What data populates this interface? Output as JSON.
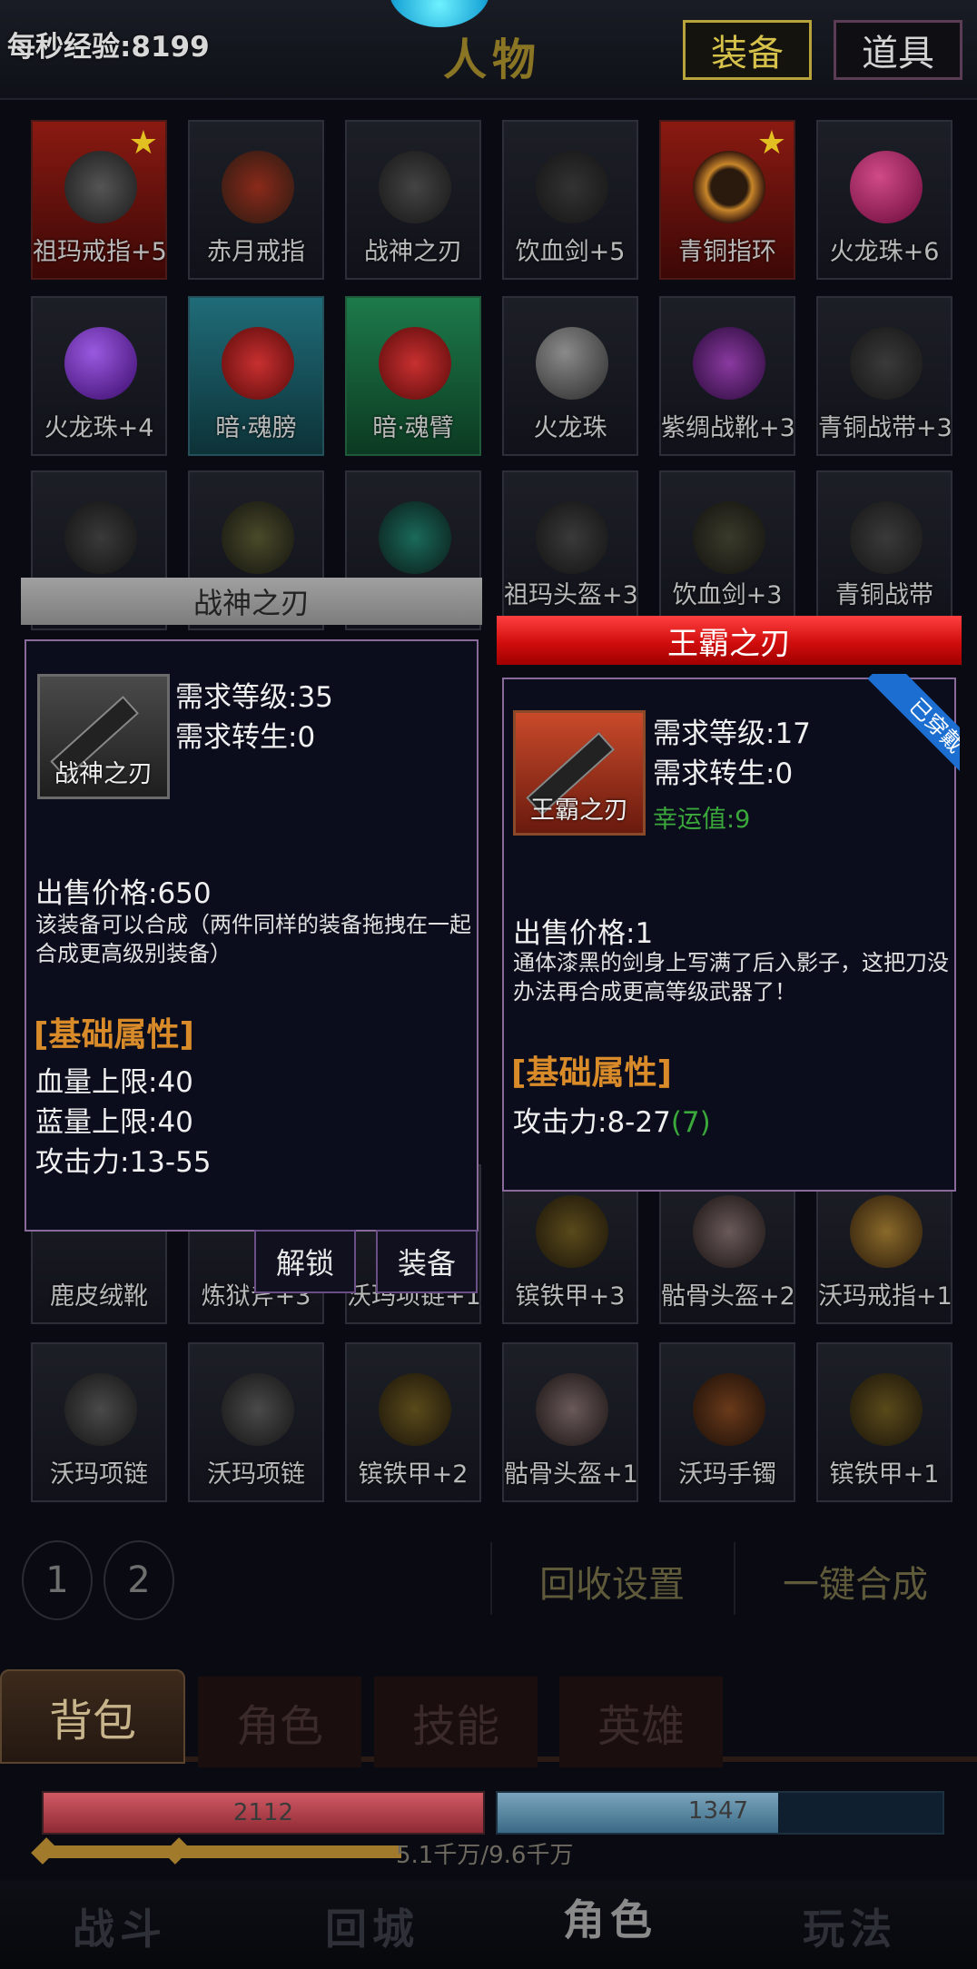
{
  "header": {
    "exp_per_sec": "每秒经验:8199",
    "title": "人物",
    "tab_equip": "装备",
    "tab_items": "道具"
  },
  "grid": {
    "row1": [
      "祖玛戒指+5",
      "赤月戒指",
      "战神之刃",
      "饮血剑+5",
      "青铜指环",
      "火龙珠+6"
    ],
    "row2": [
      "火龙珠+4",
      "暗·魂膀",
      "暗·魂臂",
      "火龙珠",
      "紫绸战靴+3",
      "青铜战带+3"
    ],
    "row3": [
      "祖玛头盔+3",
      "饮血剑+3",
      "青铜战带"
    ],
    "row5": [
      "鹿皮绒靴",
      "炼狱斧+3",
      "沃玛项链+1",
      "镔铁甲+3",
      "骷骨头盔+2",
      "沃玛戒指+1"
    ],
    "row6": [
      "沃玛项链",
      "沃玛项链",
      "镔铁甲+2",
      "骷骨头盔+1",
      "沃玛手镯",
      "镔铁甲+1"
    ]
  },
  "popup_left": {
    "title": "战神之刃",
    "icon_name": "战神之刃",
    "req_level": "需求等级:35",
    "req_rebirth": "需求转生:0",
    "price": "出售价格:650",
    "desc_line1": "该装备可以合成（两件同样的装备拖拽在一起",
    "desc_line2": "合成更高级别装备）",
    "attr_header": "[基础属性]",
    "attr1": "血量上限:40",
    "attr2": "蓝量上限:40",
    "attr3": "攻击力:13-55",
    "btn_unlock": "解锁",
    "btn_equip": "装备"
  },
  "popup_right": {
    "title": "王霸之刃",
    "icon_name": "王霸之刃",
    "badge": "已穿戴",
    "req_level": "需求等级:17",
    "req_rebirth": "需求转生:0",
    "luck": "幸运值:9",
    "price": "出售价格:1",
    "desc_line1": "通体漆黑的剑身上写满了后入影子，这把刀没",
    "desc_line2": "办法再合成更高等级武器了！",
    "attr_header": "[基础属性]",
    "attack": "攻击力:8-27",
    "attack_bonus": "(7)"
  },
  "controls": {
    "page1": "1",
    "page2": "2",
    "recycle": "回收设置",
    "merge": "一键合成"
  },
  "bag_tabs": {
    "bag": "背包",
    "role": "角色",
    "skill": "技能",
    "hero": "英雄"
  },
  "status": {
    "hp": "2112",
    "mp": "1347",
    "mp_fill": 0.63,
    "exp_fill": 0.41,
    "exp": "5.1千万/9.6千万"
  },
  "nav": {
    "battle": "战斗",
    "town": "回城",
    "role": "角色",
    "play": "玩法"
  },
  "colors": {
    "accent_gold": "#b8a23a",
    "title_red": "#d10d0d",
    "attr_orange": "#d98b2a",
    "luck_green": "#3aa83a"
  }
}
